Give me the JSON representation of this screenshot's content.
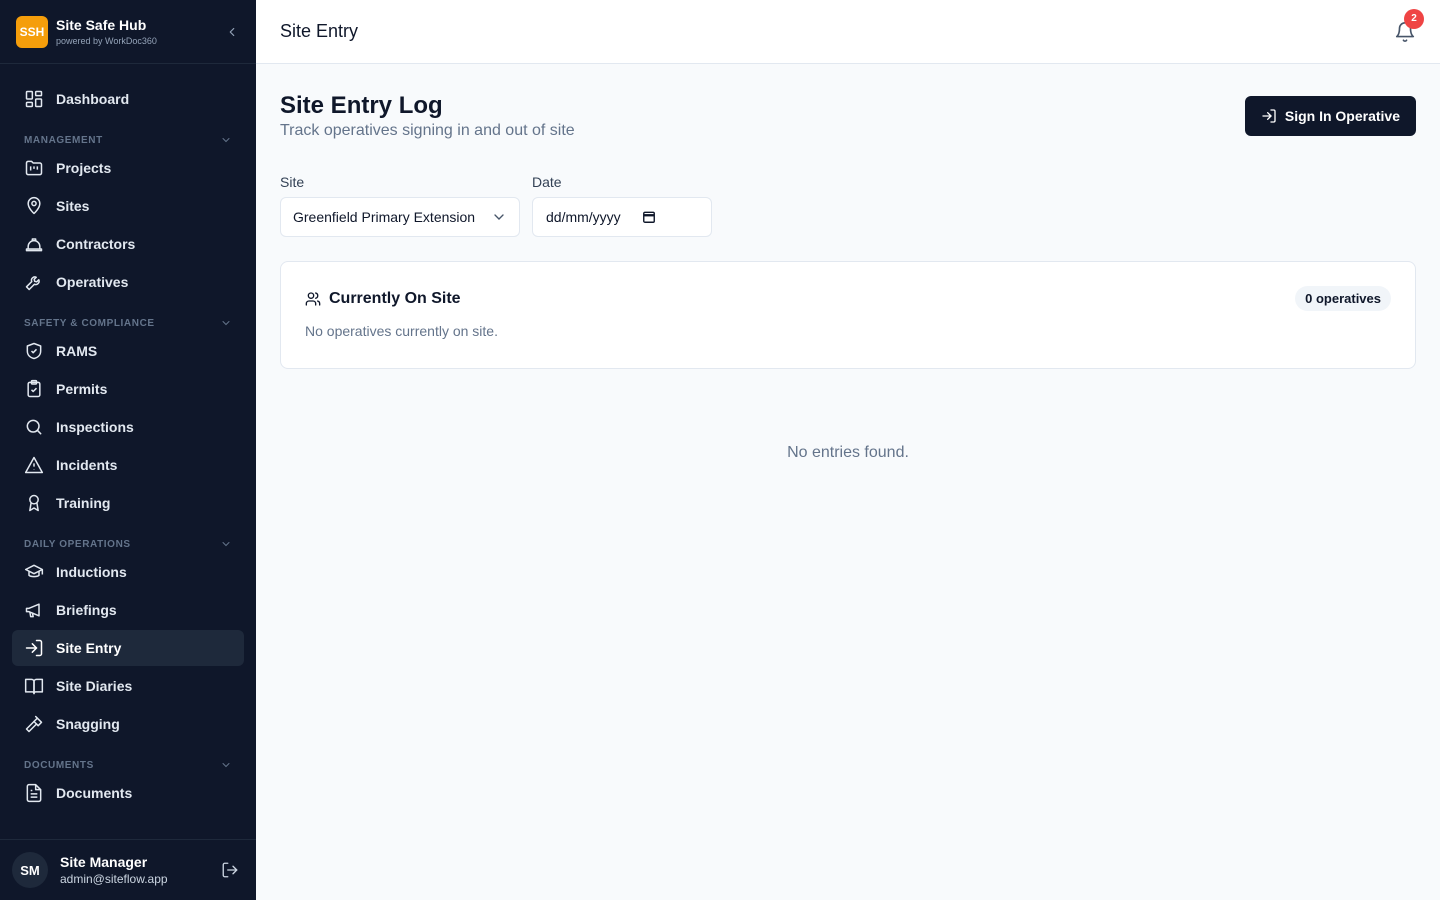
{
  "brand": {
    "logo": "SSH",
    "name": "Site Safe Hub",
    "sub": "powered by WorkDoc360"
  },
  "sidebar": {
    "dashboard": "Dashboard",
    "sections": {
      "management": "MANAGEMENT",
      "safety": "SAFETY & COMPLIANCE",
      "daily": "DAILY OPERATIONS",
      "documents": "DOCUMENTS"
    },
    "management": [
      "Projects",
      "Sites",
      "Contractors",
      "Operatives"
    ],
    "safety": [
      "RAMS",
      "Permits",
      "Inspections",
      "Incidents",
      "Training"
    ],
    "daily": [
      "Inductions",
      "Briefings",
      "Site Entry",
      "Site Diaries",
      "Snagging"
    ],
    "documents": [
      "Documents"
    ],
    "active": "Site Entry"
  },
  "user": {
    "initials": "SM",
    "name": "Site Manager",
    "email": "admin@siteflow.app"
  },
  "header": {
    "title": "Site Entry",
    "notification_count": "2"
  },
  "page": {
    "title": "Site Entry Log",
    "subtitle": "Track operatives signing in and out of site",
    "primary_button": "Sign In Operative"
  },
  "filters": {
    "site_label": "Site",
    "site_value": "Greenfield Primary Extension",
    "date_label": "Date",
    "date_placeholder": "dd/mm/yyyy"
  },
  "on_site": {
    "title": "Currently On Site",
    "count_label": "0 operatives",
    "empty": "No operatives currently on site."
  },
  "entries": {
    "empty": "No entries found."
  },
  "colors": {
    "sidebar_bg": "#0f172a",
    "brand_accent": "#f59e0b",
    "badge": "#ef4444",
    "primary": "#0f172a"
  }
}
